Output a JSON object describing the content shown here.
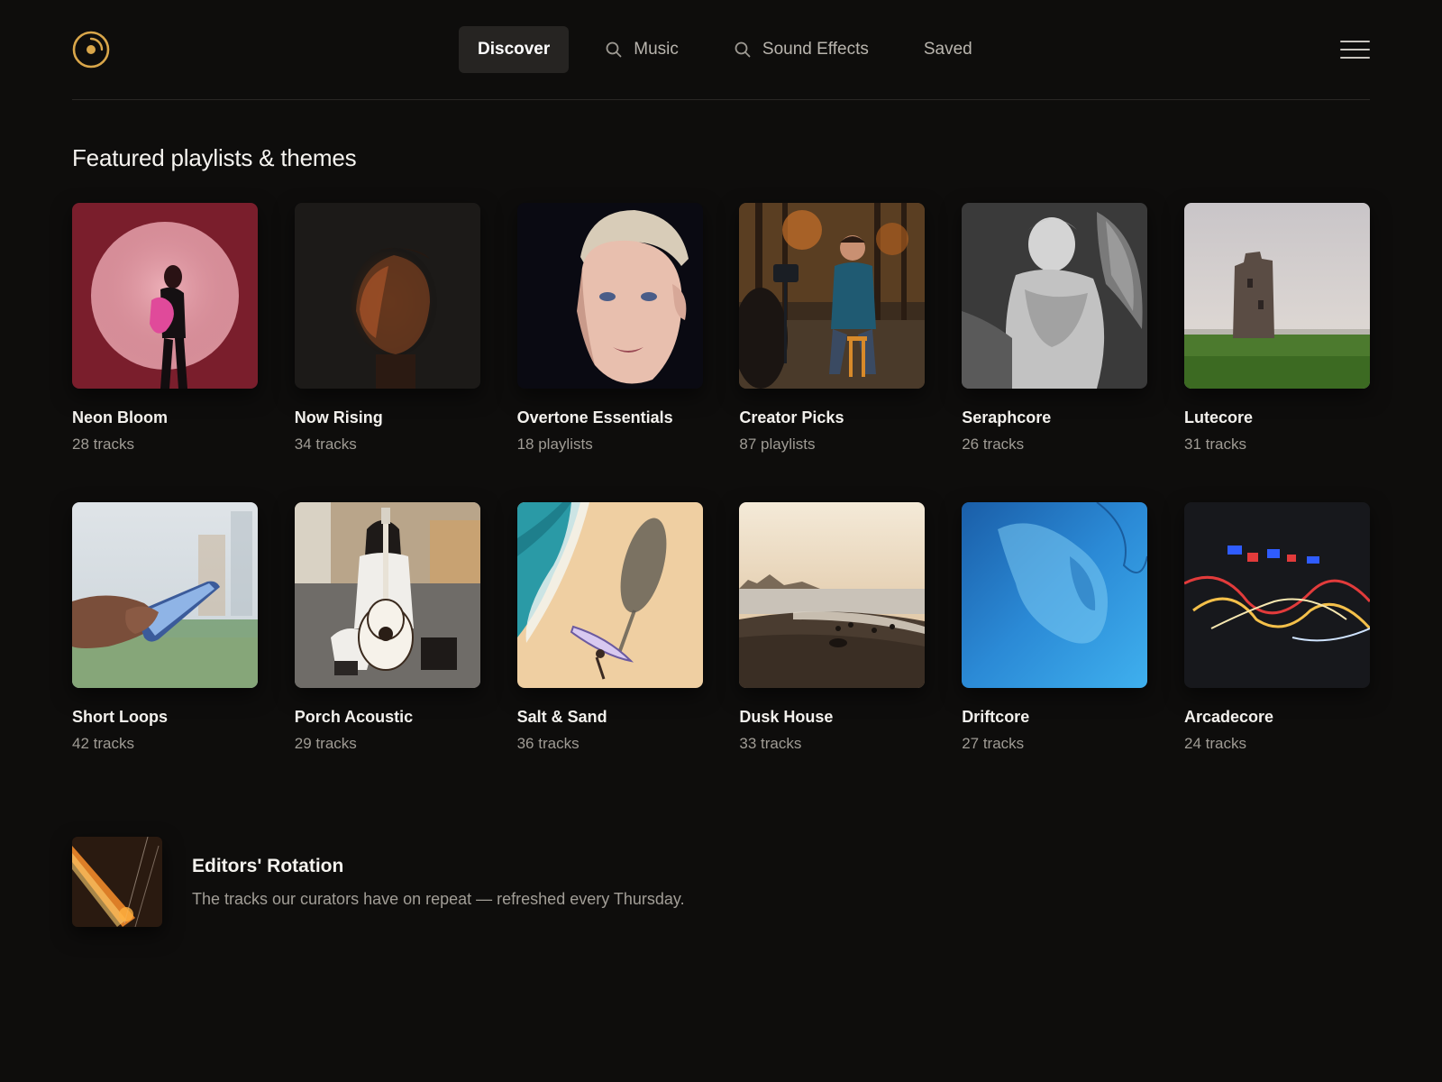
{
  "brand": {
    "name": "logo",
    "accent": "#d9a64a"
  },
  "nav": {
    "items": [
      {
        "label": "Discover",
        "icon": "",
        "active": true
      },
      {
        "label": "Music",
        "icon": "search-icon",
        "active": false
      },
      {
        "label": "Sound Effects",
        "icon": "search-icon",
        "active": false
      },
      {
        "label": "Saved",
        "icon": "",
        "active": false
      }
    ]
  },
  "featured": {
    "title": "Featured playlists & themes",
    "items": [
      {
        "title": "Neon Bloom",
        "count": "28 tracks",
        "art": "neon-bloom"
      },
      {
        "title": "Now Rising",
        "count": "34 tracks",
        "art": "now-rising"
      },
      {
        "title": "Overtone Essentials",
        "count": "18 playlists",
        "art": "overtone"
      },
      {
        "title": "Creator Picks",
        "count": "87 playlists",
        "art": "creator"
      },
      {
        "title": "Seraphcore",
        "count": "26 tracks",
        "art": "seraph"
      },
      {
        "title": "Lutecore",
        "count": "31 tracks",
        "art": "lute"
      },
      {
        "title": "Short Loops",
        "count": "42 tracks",
        "art": "loops"
      },
      {
        "title": "Porch Acoustic",
        "count": "29 tracks",
        "art": "porch"
      },
      {
        "title": "Salt & Sand",
        "count": "36 tracks",
        "art": "salt"
      },
      {
        "title": "Dusk House",
        "count": "33 tracks",
        "art": "dusk"
      },
      {
        "title": "Driftcore",
        "count": "27 tracks",
        "art": "drift"
      },
      {
        "title": "Arcadecore",
        "count": "24 tracks",
        "art": "arcade"
      }
    ]
  },
  "rotation": {
    "title": "Editors' Rotation",
    "description": "The tracks our curators have on repeat — refreshed every Thursday."
  }
}
